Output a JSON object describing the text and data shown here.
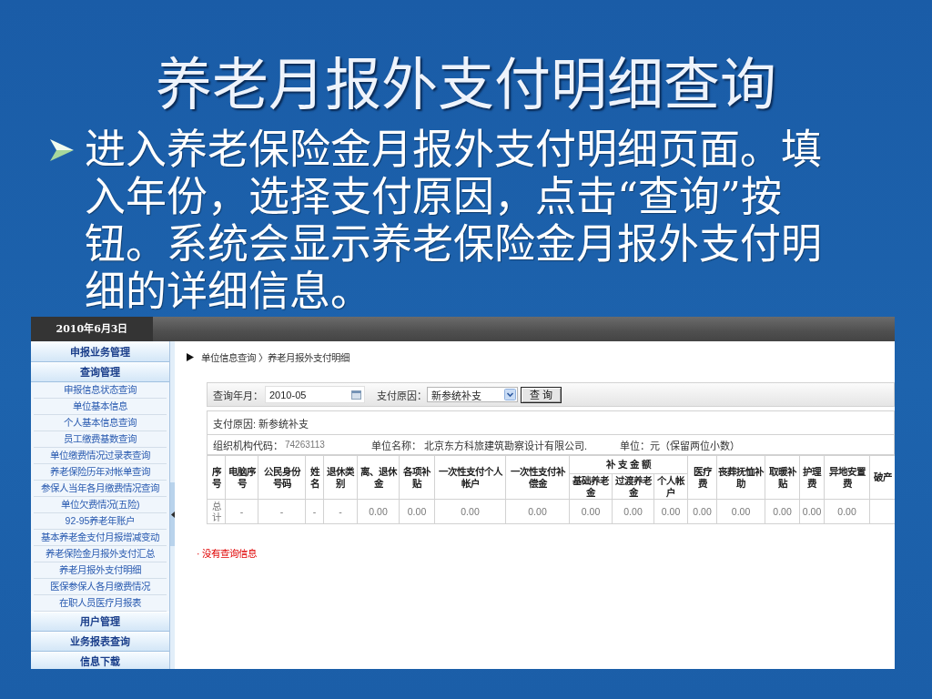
{
  "slide": {
    "title": "养老月报外支付明细查询",
    "bullets": [
      {
        "text": "进入养老保险金月报外支付明细页面。填入年份，选择支付原因，点击“查询”按钮。系统会显示养老保险金月报外支付明细的详细信息。"
      }
    ]
  },
  "screenshot": {
    "top_bar": {
      "date": "2010年6月3日"
    },
    "sidebar": {
      "groups": [
        {
          "title": "申报业务管理"
        },
        {
          "title": "查询管理",
          "items": [
            "申报信息状态查询",
            "单位基本信息",
            "个人基本信息查询",
            "员工缴费基数查询",
            "单位缴费情况过录表查询",
            "养老保险历年对帐单查询",
            "参保人当年各月缴费情况查询",
            "单位欠费情况(五险)",
            "92-95养老年账户",
            "基本养老金支付月报增减变动",
            "养老保险金月报外支付汇总",
            "养老月报外支付明细",
            "医保参保人各月缴费情况",
            "在职人员医疗月报表"
          ]
        },
        {
          "title": "用户管理"
        },
        {
          "title": "业务报表查询"
        },
        {
          "title": "信息下载"
        }
      ]
    },
    "breadcrumb": "单位信息查询 〉养老月报外支付明细",
    "query_form": {
      "fields": [
        {
          "kind": "date",
          "label": "查询年月：",
          "value": "2010-05"
        },
        {
          "kind": "select",
          "label": "支付原因：",
          "value": "新参统补支"
        }
      ],
      "button": "查 询"
    },
    "summary": {
      "reason": "支付原因: 新参统补支",
      "org_code_label": "组织机构代码：",
      "org_code": "74263113",
      "unit_name_label": "单位名称：",
      "unit_name": "北京东方科旅建筑勘察设计有限公司.",
      "unit_note": "单位：元（保留两位小数）"
    },
    "table": {
      "columns": [
        {
          "label": "序号"
        },
        {
          "label": "电脑序号"
        },
        {
          "label": "公民身份号码"
        },
        {
          "label": "姓名"
        },
        {
          "label": "退休类别"
        },
        {
          "label": "离、退休金"
        },
        {
          "label": "各项补贴"
        },
        {
          "label": "一次性支付个人帐户"
        },
        {
          "label": "一次性支付补偿金"
        },
        {
          "label": "补 支 金 额",
          "colspan": 3,
          "children": [
            {
              "label": "基础养老金"
            },
            {
              "label": "过渡养老金"
            },
            {
              "label": "个人帐户"
            }
          ]
        },
        {
          "label": "医疗费"
        },
        {
          "label": "丧葬抚恤补助"
        },
        {
          "label": "取暖补贴"
        },
        {
          "label": "护理费"
        },
        {
          "label": "异地安置费"
        },
        {
          "label": "破产"
        }
      ],
      "rows": [
        [
          "总计",
          "-",
          "-",
          "-",
          "-",
          "0.00",
          "0.00",
          "0.00",
          "0.00",
          "0.00",
          "0.00",
          "0.00",
          "0.00",
          "0.00",
          "0.00",
          "0.00",
          "0.00"
        ]
      ]
    },
    "message": "· 没有查询信息"
  }
}
